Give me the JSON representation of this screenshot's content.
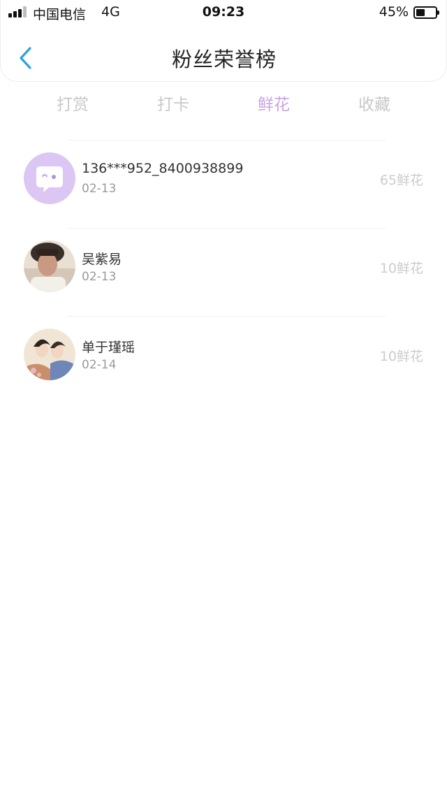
{
  "status_bar": {
    "carrier": "中国电信",
    "network": "4G",
    "time": "09:23",
    "battery": "45%",
    "battery_level": 0.45
  },
  "header": {
    "back_icon": "chevron-left-icon",
    "title": "粉丝荣誉榜"
  },
  "tabs": [
    {
      "label": "打赏",
      "active": false
    },
    {
      "label": "打卡",
      "active": false
    },
    {
      "label": "鲜花",
      "active": true
    },
    {
      "label": "收藏",
      "active": false
    }
  ],
  "fans": [
    {
      "name": "136***952_8400938899",
      "date": "02-13",
      "amount": "65鲜花",
      "avatar": "default-chat-avatar"
    },
    {
      "name": "吴紫易",
      "date": "02-13",
      "amount": "10鲜花",
      "avatar": "photo-avatar"
    },
    {
      "name": "单于瑾瑶",
      "date": "02-14",
      "amount": "10鲜花",
      "avatar": "illustration-avatar"
    }
  ],
  "colors": {
    "accent": "#c7a6e0",
    "back_icon": "#2aa0e6",
    "default_avatar_bg": "#dcc6f3",
    "inactive_tab": "#c8c8c8",
    "amount": "#cccccc"
  }
}
